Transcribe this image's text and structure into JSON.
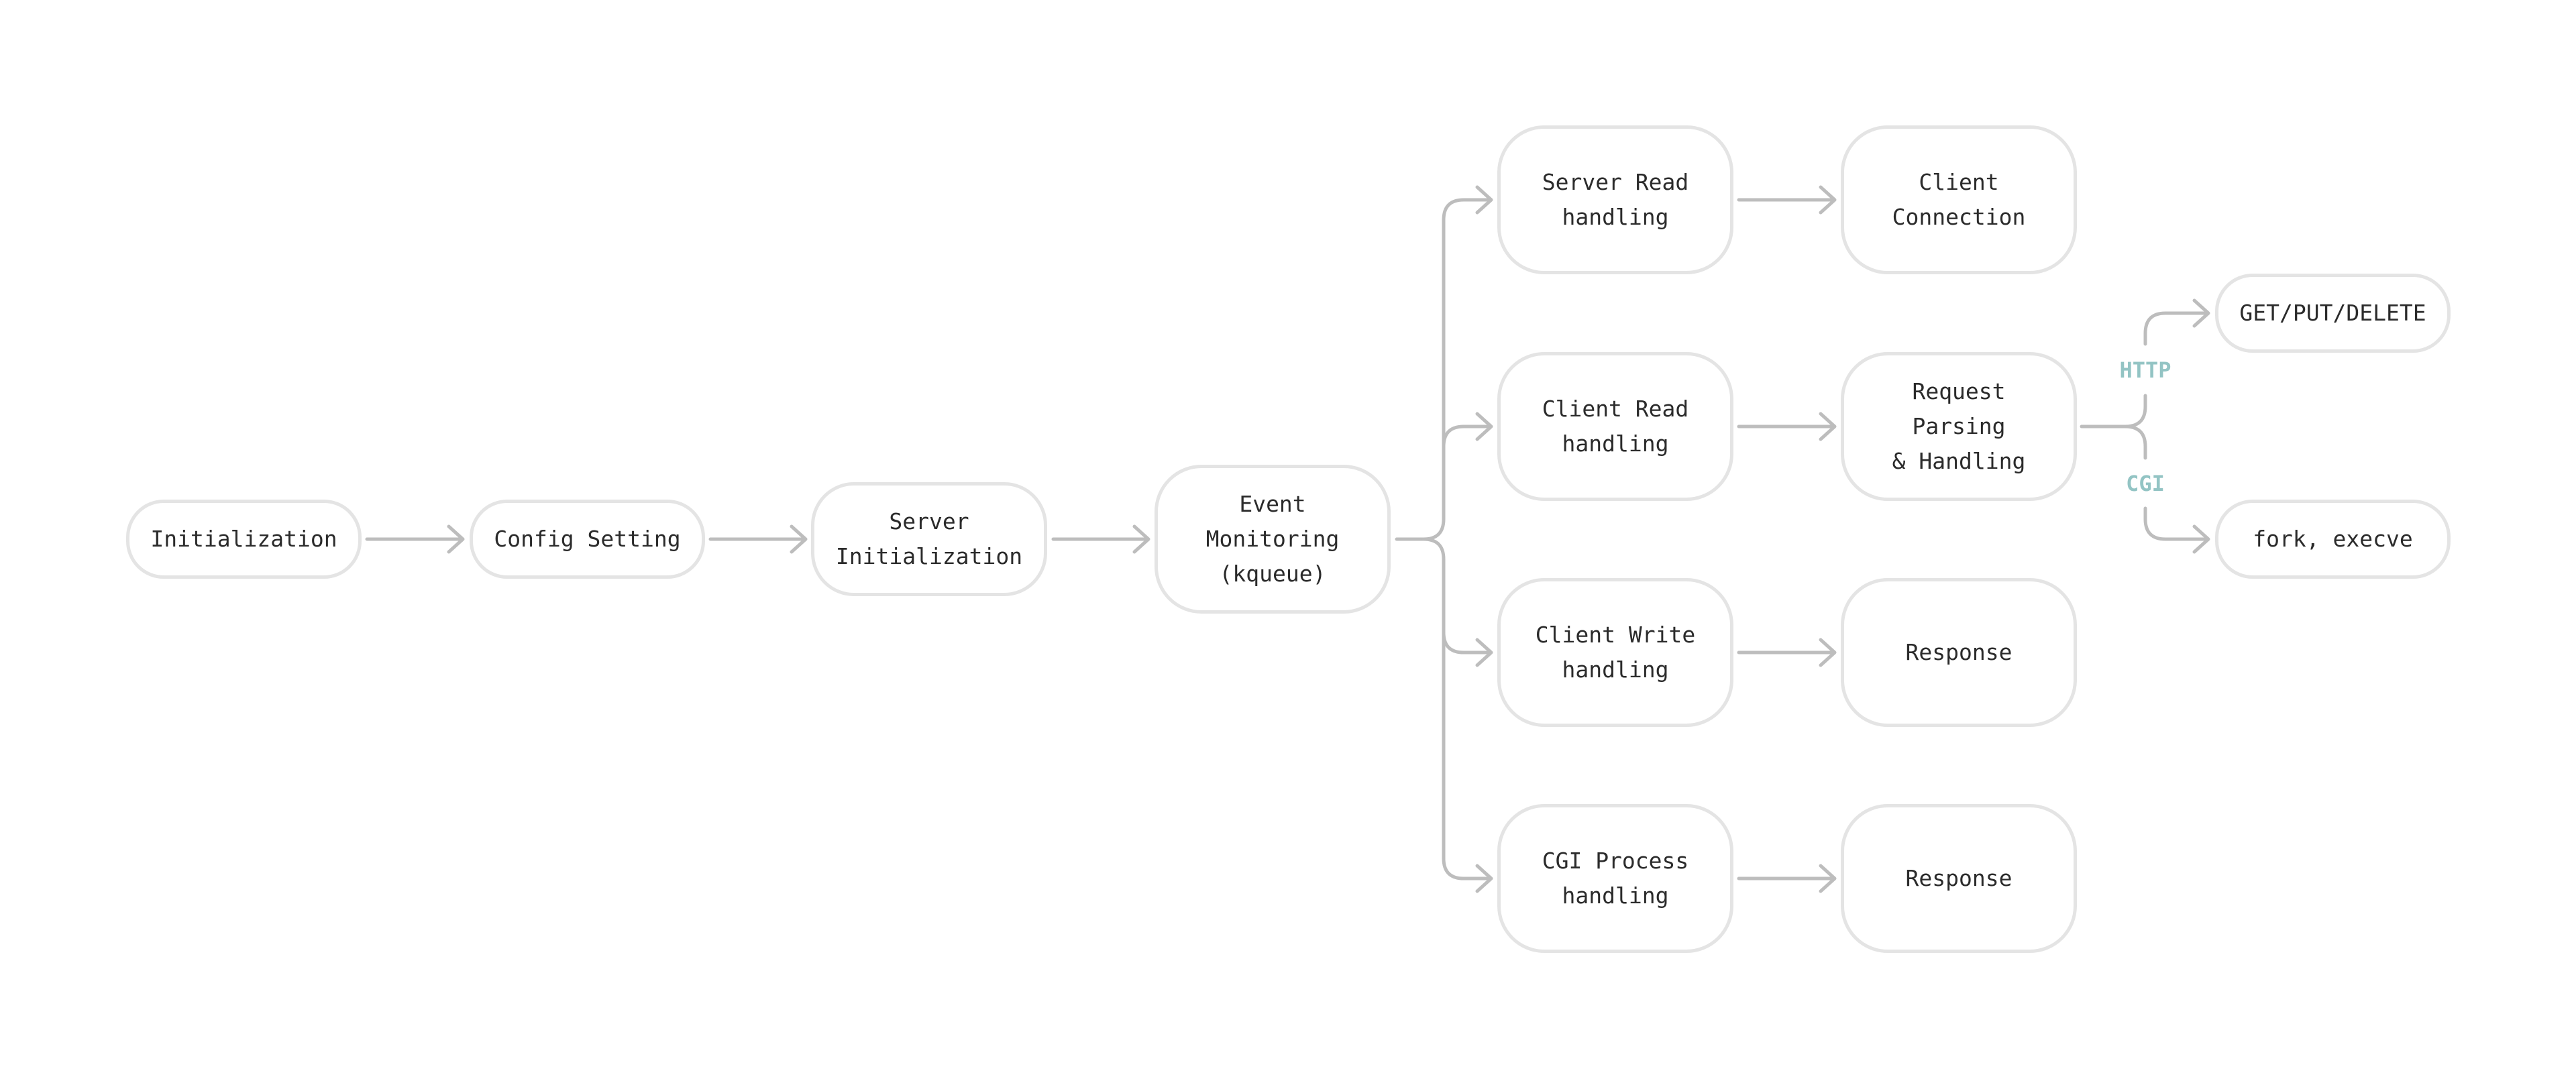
{
  "diagram": {
    "type": "flowchart",
    "colors": {
      "node_border": "#e4e4e4",
      "node_text": "#2b2b2b",
      "edge": "#bdbdbd",
      "branch_label": "#93c4c4"
    },
    "nodes": {
      "initialization": "Initialization",
      "config_setting": "Config Setting",
      "server_initialization": "Server\nInitialization",
      "event_monitoring": "Event\nMonitoring\n(kqueue)",
      "server_read": "Server Read\nhandling",
      "client_connection": "Client\nConnection",
      "client_read": "Client Read\nhandling",
      "request_parsing": "Request\nParsing\n& Handling",
      "client_write": "Client Write\nhandling",
      "response_write": "Response",
      "cgi_process": "CGI Process\nhandling",
      "response_cgi": "Response",
      "get_put_delete": "GET/PUT/DELETE",
      "fork_execve": "fork, execve"
    },
    "branch_labels": {
      "http": "HTTP",
      "cgi": "CGI"
    },
    "edges": [
      {
        "from": "initialization",
        "to": "config_setting"
      },
      {
        "from": "config_setting",
        "to": "server_initialization"
      },
      {
        "from": "server_initialization",
        "to": "event_monitoring"
      },
      {
        "from": "event_monitoring",
        "to": "server_read"
      },
      {
        "from": "event_monitoring",
        "to": "client_read"
      },
      {
        "from": "event_monitoring",
        "to": "client_write"
      },
      {
        "from": "event_monitoring",
        "to": "cgi_process"
      },
      {
        "from": "server_read",
        "to": "client_connection"
      },
      {
        "from": "client_read",
        "to": "request_parsing"
      },
      {
        "from": "client_write",
        "to": "response_write"
      },
      {
        "from": "cgi_process",
        "to": "response_cgi"
      },
      {
        "from": "request_parsing",
        "to": "get_put_delete",
        "label": "HTTP"
      },
      {
        "from": "request_parsing",
        "to": "fork_execve",
        "label": "CGI"
      }
    ]
  }
}
